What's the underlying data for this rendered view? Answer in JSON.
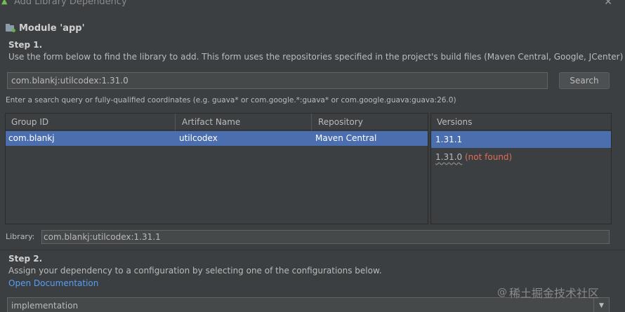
{
  "window": {
    "title": "Add Library Dependency",
    "app_icon": "android-icon",
    "close_icon": "close-icon",
    "close_glyph": "✕"
  },
  "module": {
    "icon": "module-folder-icon",
    "label": "Module 'app'"
  },
  "step1": {
    "title": "Step 1.",
    "description": "Use the form below to find the library to add. This form uses the repositories specified in the project's build files (Maven Central, Google, JCenter)"
  },
  "search": {
    "value": "com.blankj:utilcodex:1.31.0",
    "button_label": "Search",
    "hint": "Enter a search query or fully-qualified coordinates (e.g. guava* or com.google.*:guava* or com.google.guava:guava:26.0)"
  },
  "results": {
    "columns": [
      "Group ID",
      "Artifact Name",
      "Repository"
    ],
    "rows": [
      {
        "group_id": "com.blankj",
        "artifact": "utilcodex",
        "repository": "Maven Central"
      }
    ]
  },
  "versions": {
    "header": "Versions",
    "items": [
      {
        "version": "1.31.1",
        "note": ""
      },
      {
        "version": "1.31.0",
        "note": "(not found)"
      }
    ]
  },
  "library": {
    "label": "Library:",
    "value": "com.blankj:utilcodex:1.31.1"
  },
  "step2": {
    "title": "Step 2.",
    "description": "Assign your dependency to a configuration by selecting one of the configurations below.",
    "doc_link": "Open Documentation"
  },
  "configuration": {
    "selected": "implementation",
    "arrow_glyph": "▼"
  },
  "watermark": {
    "at": "@",
    "text": "稀土掘金技术社区"
  },
  "colors": {
    "background": "#3c3f41",
    "selection": "#4b6eaf",
    "link": "#589df6",
    "error": "#e06c5a"
  }
}
